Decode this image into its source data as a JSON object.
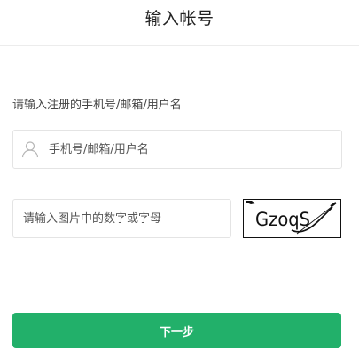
{
  "header": {
    "title": "输入帐号"
  },
  "form": {
    "prompt": "请输入注册的手机号/邮箱/用户名",
    "account": {
      "icon": "user-icon",
      "value": "",
      "placeholder": "手机号/邮箱/用户名"
    },
    "captcha": {
      "value": "",
      "placeholder": "请输入图片中的数字或字母",
      "image_text": "GzoqS"
    },
    "next_label": "下一步"
  },
  "colors": {
    "accent": "#22b06a",
    "border": "#e4e4e4",
    "text": "#444444"
  }
}
